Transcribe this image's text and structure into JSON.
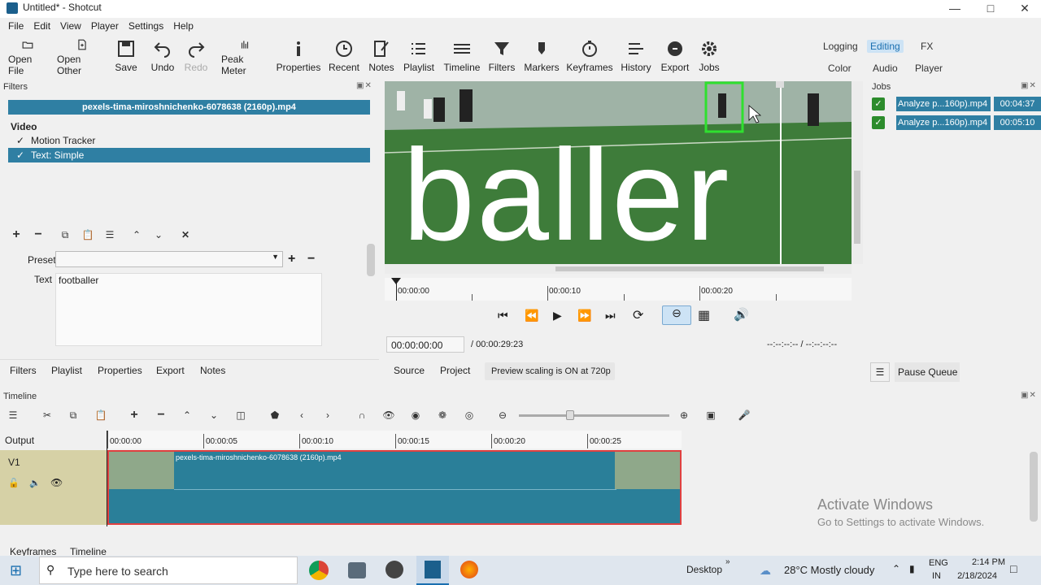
{
  "window": {
    "title": "Untitled* - Shotcut"
  },
  "menu": [
    "File",
    "Edit",
    "View",
    "Player",
    "Settings",
    "Help"
  ],
  "toolbar": {
    "open_file": "Open File",
    "open_other": "Open Other",
    "save": "Save",
    "undo": "Undo",
    "redo": "Redo",
    "peak_meter": "Peak Meter",
    "properties": "Properties",
    "recent": "Recent",
    "notes": "Notes",
    "playlist": "Playlist",
    "timeline": "Timeline",
    "filters": "Filters",
    "markers": "Markers",
    "keyframes": "Keyframes",
    "history": "History",
    "export": "Export",
    "jobs": "Jobs"
  },
  "modes": {
    "logging": "Logging",
    "editing": "Editing",
    "fx": "FX",
    "color": "Color",
    "audio": "Audio",
    "player": "Player"
  },
  "filters_panel": {
    "title": "Filters",
    "clip_name": "pexels-tima-miroshnichenko-6078638 (2160p).mp4",
    "section": "Video",
    "items": [
      {
        "check": "✓",
        "label": "Motion Tracker"
      },
      {
        "check": "✓",
        "label": "Text: Simple"
      }
    ],
    "preset_label": "Preset",
    "text_label": "Text",
    "text_value": "footballer"
  },
  "left_tabs": [
    "Filters",
    "Playlist",
    "Properties",
    "Export",
    "Notes"
  ],
  "viewer": {
    "overlay_text": "baller",
    "ruler": [
      "00:00:00",
      "00:00:10",
      "00:00:20"
    ],
    "current_time": "00:00:00:00",
    "duration": "/ 00:00:29:23",
    "in_out": "--:--:--:-- / --:--:--:--",
    "tabs": {
      "source": "Source",
      "project": "Project"
    },
    "scaling_note": "Preview scaling is ON at 720p"
  },
  "jobs": {
    "title": "Jobs",
    "items": [
      {
        "name": "Analyze p...160p).mp4",
        "time": "00:04:37"
      },
      {
        "name": "Analyze p...160p).mp4",
        "time": "00:05:10"
      }
    ],
    "pause_queue": "Pause Queue"
  },
  "timeline": {
    "title": "Timeline",
    "output_label": "Output",
    "track": "V1",
    "ruler": [
      "00:00:00",
      "00:00:05",
      "00:00:10",
      "00:00:15",
      "00:00:20",
      "00:00:25"
    ],
    "clip_name": "pexels-tima-miroshnichenko-6078638 (2160p).mp4"
  },
  "bottom_tabs": [
    "Keyframes",
    "Timeline"
  ],
  "watermark": {
    "line1": "Activate Windows",
    "line2": "Go to Settings to activate Windows."
  },
  "taskbar": {
    "search_placeholder": "Type here to search",
    "desktop": "Desktop",
    "weather": "28°C  Mostly cloudy",
    "lang1": "ENG",
    "lang2": "IN",
    "time": "2:14 PM",
    "date": "2/18/2024"
  },
  "colors": {
    "accent": "#2f7fa3",
    "selection": "#2f7fa3",
    "timeline_clip": "#2a7f99",
    "playhead_border": "#e04040"
  }
}
